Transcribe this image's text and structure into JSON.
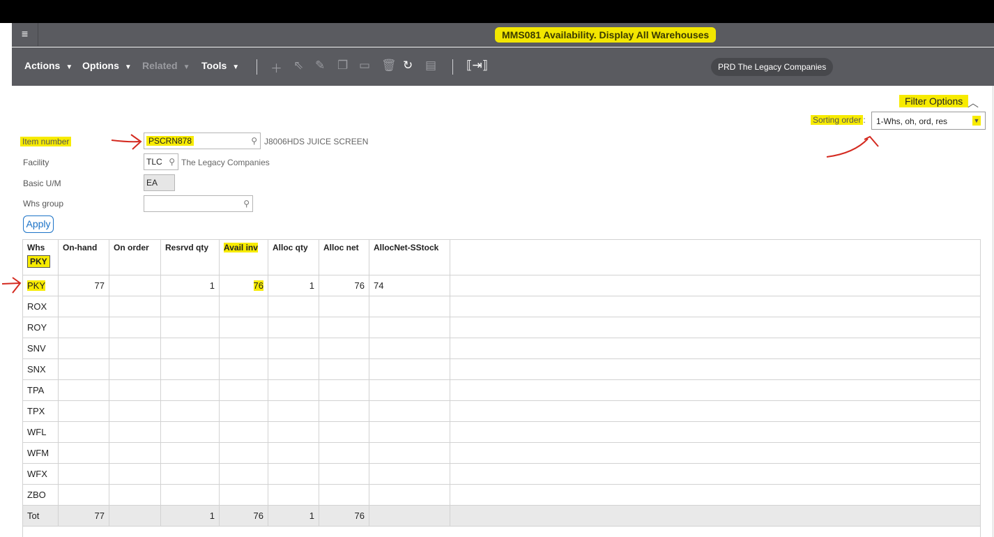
{
  "window": {
    "title": "MMS081 Availability. Display All Warehouses",
    "menu_icon": "hamburger-icon"
  },
  "toolbar": {
    "menus": [
      "Actions",
      "Options",
      "Related",
      "Tools"
    ],
    "environment": "PRD The Legacy Companies"
  },
  "filter": {
    "title": "Filter Options",
    "sorting_label": "Sorting order",
    "sorting_value": "1-Whs, oh, ord, res"
  },
  "fields": {
    "item_number_label": "Item number",
    "item_number_value": "PSCRN878",
    "item_description": "J8006HDS JUICE SCREEN",
    "facility_label": "Facility",
    "facility_value": "TLC",
    "facility_description": "The Legacy Companies",
    "basic_um_label": "Basic U/M",
    "basic_um_value": "EA",
    "whs_group_label": "Whs group",
    "whs_group_value": ""
  },
  "apply_label": "Apply",
  "table": {
    "headers": [
      "Whs",
      "On-hand",
      "On order",
      "Resrvd qty",
      "Avail inv",
      "Alloc qty",
      "Alloc net",
      "AllocNet-SStock"
    ],
    "whs_filter": "PKY",
    "rows": [
      [
        "PKY",
        "77",
        "",
        "1",
        "76",
        "1",
        "76",
        "74"
      ],
      [
        "ROX",
        "",
        "",
        "",
        "",
        "",
        "",
        ""
      ],
      [
        "ROY",
        "",
        "",
        "",
        "",
        "",
        "",
        ""
      ],
      [
        "SNV",
        "",
        "",
        "",
        "",
        "",
        "",
        ""
      ],
      [
        "SNX",
        "",
        "",
        "",
        "",
        "",
        "",
        ""
      ],
      [
        "TPA",
        "",
        "",
        "",
        "",
        "",
        "",
        ""
      ],
      [
        "TPX",
        "",
        "",
        "",
        "",
        "",
        "",
        ""
      ],
      [
        "WFL",
        "",
        "",
        "",
        "",
        "",
        "",
        ""
      ],
      [
        "WFM",
        "",
        "",
        "",
        "",
        "",
        "",
        ""
      ],
      [
        "WFX",
        "",
        "",
        "",
        "",
        "",
        "",
        ""
      ],
      [
        "ZBO",
        "",
        "",
        "",
        "",
        "",
        "",
        ""
      ]
    ],
    "total": [
      "Tot",
      "77",
      "",
      "1",
      "76",
      "1",
      "76",
      ""
    ]
  }
}
